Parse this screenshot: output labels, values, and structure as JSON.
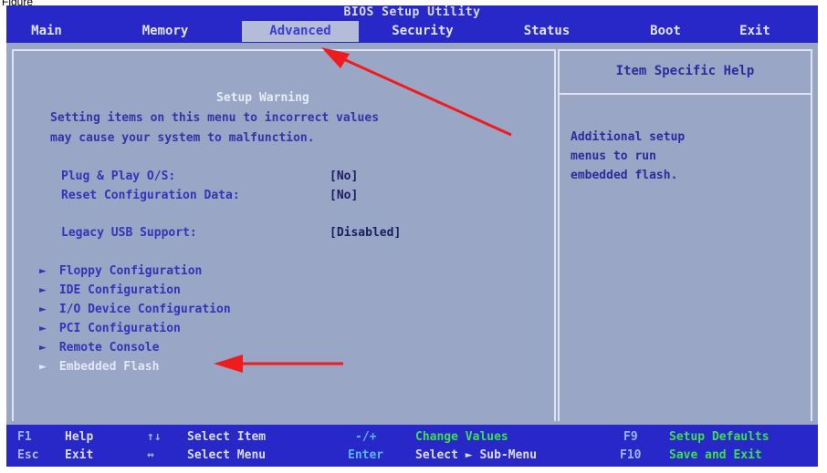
{
  "figure_label": "Figure",
  "bios": {
    "title": "BIOS Setup Utility",
    "menu": [
      {
        "label": "Main",
        "active": false
      },
      {
        "label": "Memory",
        "active": false
      },
      {
        "label": "Advanced",
        "active": true
      },
      {
        "label": "Security",
        "active": false
      },
      {
        "label": "Status",
        "active": false
      },
      {
        "label": "Boot",
        "active": false
      },
      {
        "label": "Exit",
        "active": false
      }
    ],
    "warning": {
      "title": "Setup Warning",
      "lines": [
        "Setting items on this menu to incorrect values",
        "may cause your system to malfunction."
      ]
    },
    "options": [
      {
        "label": "Plug & Play O/S:",
        "value": "[No]"
      },
      {
        "label": "Reset Configuration Data:",
        "value": "[No]"
      },
      {
        "label": "Legacy USB Support:",
        "value": "[Disabled]"
      }
    ],
    "submenus": [
      {
        "label": "Floppy Configuration",
        "highlighted": false
      },
      {
        "label": "IDE Configuration",
        "highlighted": false
      },
      {
        "label": "I/O Device Configuration",
        "highlighted": false
      },
      {
        "label": "PCI Configuration",
        "highlighted": false
      },
      {
        "label": "Remote Console",
        "highlighted": false
      },
      {
        "label": "Embedded Flash",
        "highlighted": true
      }
    ],
    "submenu_marker": "►",
    "help": {
      "title": "Item Specific Help",
      "lines": [
        "Additional setup",
        "menus to run",
        "embedded flash."
      ]
    },
    "status": [
      {
        "key": "F1",
        "label": "Help"
      },
      {
        "key": "Esc",
        "label": "Exit"
      },
      {
        "key": "↑↓",
        "label": "Select Item"
      },
      {
        "key": "↔",
        "label": "Select Menu"
      },
      {
        "key": "-/+",
        "label": "Change Values"
      },
      {
        "key": "Enter",
        "label": "Select ► Sub-Menu"
      },
      {
        "key": "F9",
        "label": "Setup Defaults"
      },
      {
        "key": "F10",
        "label": "Save and Exit"
      }
    ]
  },
  "colors": {
    "background": "#9aa6c6",
    "bar": "#2828c8",
    "annotation_arrow": "#ee1c1c"
  }
}
